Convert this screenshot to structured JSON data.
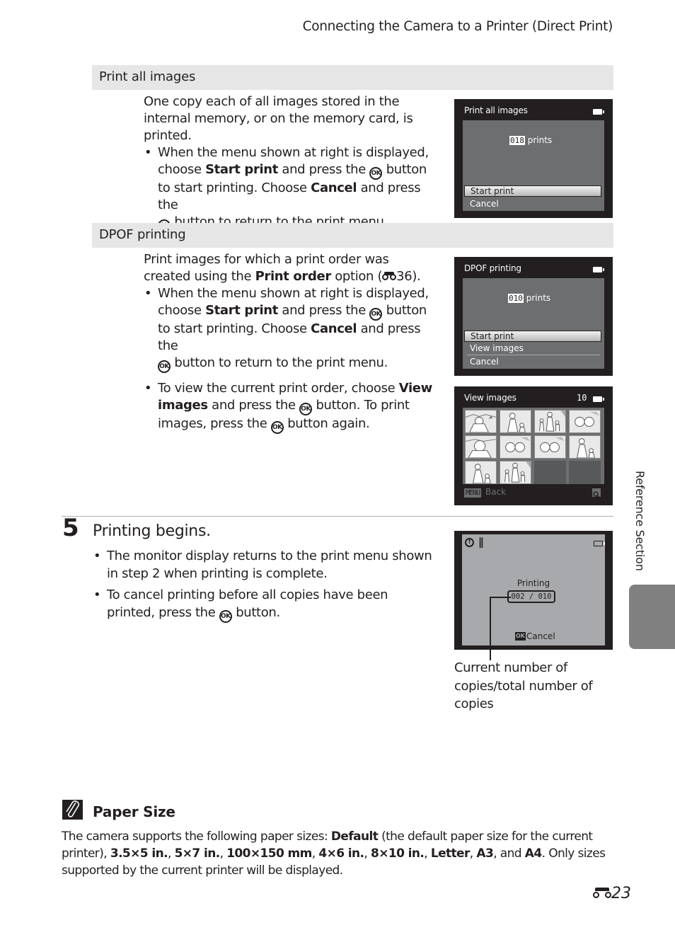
{
  "header": {
    "running_title": "Connecting the Camera to a Printer (Direct Print)"
  },
  "sections": [
    {
      "title": "Print all images",
      "intro": "One copy each of all images stored in the internal memory, or on the memory card, is printed.",
      "bullet": {
        "t1": "When the menu shown at right is displayed, choose ",
        "b1": "Start print",
        "t2": " and press the ",
        "t3": " button to start printing. Choose ",
        "b2": "Cancel",
        "t4": " and press the ",
        "t5": " button to return to the print menu."
      },
      "screen": {
        "title": "Print all images",
        "count": "018",
        "count_label": "prints",
        "menu": [
          "Start print",
          "Cancel"
        ],
        "selected": "Start print"
      }
    },
    {
      "title": "DPOF printing",
      "intro_t1": "Print images for which a print order was created using the ",
      "intro_b1": "Print order",
      "intro_t2": " option (",
      "intro_ref": "36",
      "intro_t3": ").",
      "bullet": {
        "t1": "When the menu shown at right is displayed, choose ",
        "b1": "Start print",
        "t2": " and press the ",
        "t3": " button to start printing. Choose ",
        "b2": "Cancel",
        "t4": " and press the ",
        "t5": " button to return to the print menu."
      },
      "bullet2": {
        "t1": "To view the current print order, choose ",
        "b1": "View images",
        "t2": " and press the ",
        "t3": " button. To print images, press the ",
        "t4": " button again."
      },
      "screen": {
        "title": "DPOF printing",
        "count": "010",
        "count_label": "prints",
        "menu": [
          "Start print",
          "View images",
          "Cancel"
        ],
        "selected": "Start print"
      },
      "view_screen": {
        "title": "View images",
        "count": "10",
        "thumbnails": [
          "portrait-woman-scarf",
          "woman-child",
          "family-walk",
          "flowers",
          "portrait-woman-smile",
          "flowers",
          "flowers",
          "woman-child",
          "woman-child",
          "family-walk",
          "empty",
          "empty"
        ],
        "footer_button": "MENU",
        "footer_label": "Back",
        "zoom_icon": "magnifier-icon"
      }
    }
  ],
  "step": {
    "number": "5",
    "title": "Printing begins.",
    "bullets": [
      "The monitor display returns to the print menu shown in step 2 when printing is complete.",
      {
        "t1": "To cancel printing before all copies have been printed, press the ",
        "t2": " button."
      }
    ],
    "screen": {
      "icons": [
        "warning-icon",
        "pictbridge-icon",
        "battery-icon"
      ],
      "status_label": "Printing",
      "progress_text": "002 / 010",
      "progress": {
        "current": 2,
        "total": 10
      },
      "cancel_button": "OK",
      "cancel_label": "Cancel"
    },
    "callout": "Current number of copies/total number of copies"
  },
  "ok_glyph": "OK",
  "side_tab": {
    "label": "Reference Section",
    "color": "#808080"
  },
  "note": {
    "title": "Paper Size",
    "t1": "The camera supports the following paper sizes: ",
    "sizes": [
      "Default",
      "3.5×5 in.",
      "5×7 in.",
      "100×150 mm",
      "4×6 in.",
      "8×10 in.",
      "Letter",
      "A3",
      "A4"
    ],
    "t2": " (the default paper size for the current printer), ",
    "sep": ", ",
    "and": ", and ",
    "t3": ". Only sizes supported by the current printer will be displayed."
  },
  "footer": {
    "page_prefix_icon": "reference-binoculars-icon",
    "page_number": "23"
  },
  "colors": {
    "section_bar": "#e6e6e6",
    "screen_frame": "#231f20",
    "screen_panel": "#6d6e70",
    "printing_panel": "#a7a9ac",
    "text": "#231f20"
  }
}
